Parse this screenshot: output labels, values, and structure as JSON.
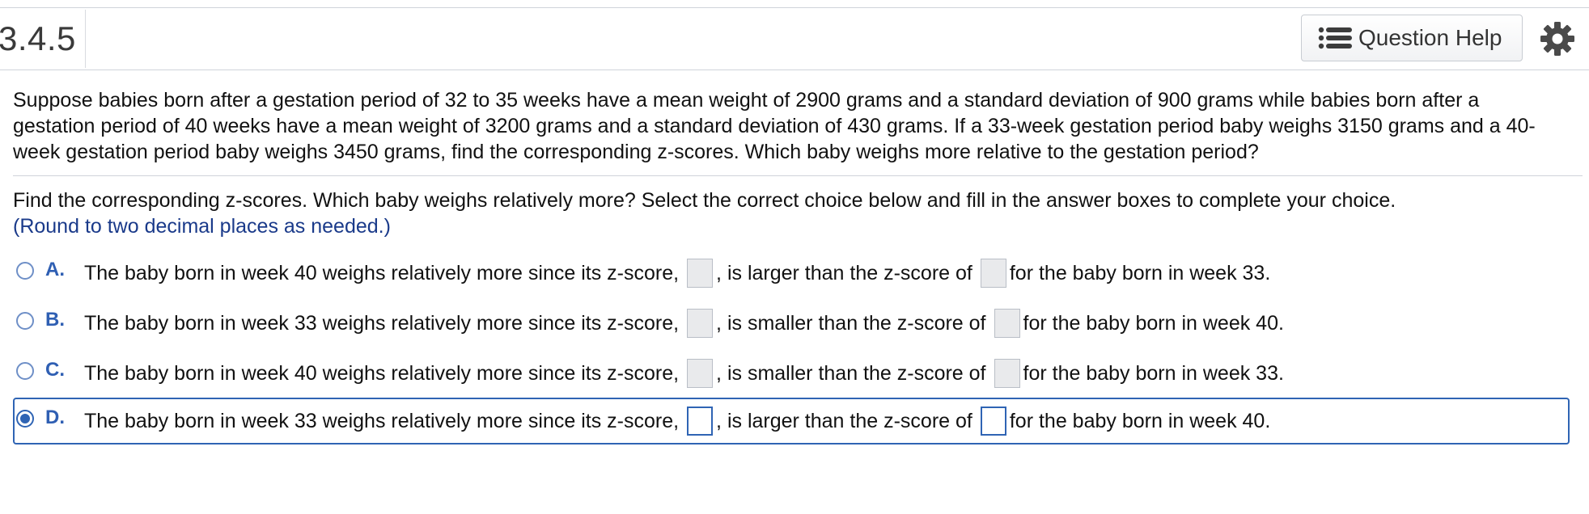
{
  "header": {
    "section_number": "3.4.5",
    "help_button_label": "Question Help",
    "help_icon": "list-icon",
    "settings_icon": "gear-icon"
  },
  "question": {
    "text": "Suppose babies born after a gestation period of 32 to 35 weeks have a mean weight of 2900 grams and a standard deviation of 900 grams while babies born after a gestation period of 40 weeks have a mean weight of 3200 grams and a standard deviation of 430 grams. If a 33-week gestation period baby weighs 3150 grams and a 40-week gestation period baby weighs 3450 grams, find the corresponding z-scores. Which baby weighs more relative to the gestation period?"
  },
  "instruction": {
    "text": "Find the corresponding z-scores. Which baby weighs relatively more? Select the correct choice below and fill in the answer boxes to complete your choice.",
    "round_note": "(Round to two decimal places as needed.)"
  },
  "choices": [
    {
      "letter": "A.",
      "part1": "The baby born in week 40 weighs relatively more since its z-score,",
      "part2": ", is larger than the z-score of",
      "part3": "for the baby born in week 33.",
      "selected": false
    },
    {
      "letter": "B.",
      "part1": "The baby born in week 33 weighs relatively more since its z-score,",
      "part2": ", is smaller than the z-score of",
      "part3": "for the baby born in week 40.",
      "selected": false
    },
    {
      "letter": "C.",
      "part1": "The baby born in week 40 weighs relatively more since its z-score,",
      "part2": ", is smaller than the z-score of",
      "part3": "for the baby born in week 33.",
      "selected": false
    },
    {
      "letter": "D.",
      "part1": "The baby born in week 33 weighs relatively more since its z-score,",
      "part2": ", is larger than the z-score of",
      "part3": "for the baby born in week 40.",
      "selected": true
    }
  ],
  "colors": {
    "accent": "#2f64b4",
    "round_note": "#1a3a8a"
  }
}
